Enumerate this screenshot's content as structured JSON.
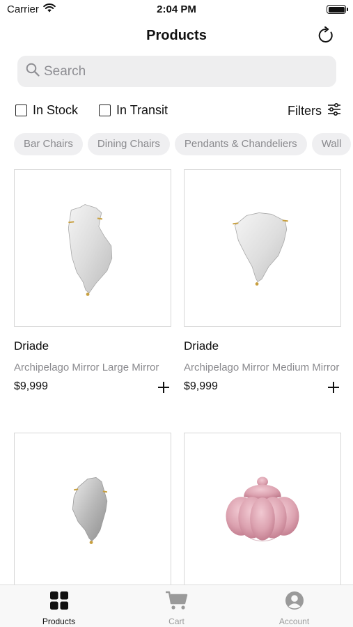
{
  "status_bar": {
    "carrier": "Carrier",
    "time": "2:04 PM"
  },
  "header": {
    "title": "Products",
    "refresh_icon": "refresh-icon"
  },
  "search": {
    "placeholder": "Search",
    "value": ""
  },
  "filters": {
    "in_stock_label": "In Stock",
    "in_stock_checked": false,
    "in_transit_label": "In Transit",
    "in_transit_checked": false,
    "filters_label": "Filters"
  },
  "categories": [
    "Bar Chairs",
    "Dining Chairs",
    "Pendants & Chandeliers",
    "Wall"
  ],
  "products": [
    {
      "brand": "Driade",
      "name": "Archipelago Mirror Large Mirror",
      "price": "$9,999",
      "image": "mirror"
    },
    {
      "brand": "Driade",
      "name": "Archipelago Mirror Medium Mirror",
      "price": "$9,999",
      "image": "mirror"
    },
    {
      "brand": "",
      "name": "",
      "price": "",
      "image": "mirror"
    },
    {
      "brand": "",
      "name": "",
      "price": "",
      "image": "pink-ceramic-jar"
    }
  ],
  "tabs": [
    {
      "label": "Products",
      "icon": "grid-icon",
      "active": true
    },
    {
      "label": "Cart",
      "icon": "cart-icon",
      "active": false
    },
    {
      "label": "Account",
      "icon": "account-icon",
      "active": false
    }
  ],
  "colors": {
    "accent": "#111111",
    "chip_bg": "#efeff1",
    "muted_text": "#8a8a8e",
    "search_bg": "#eeeeef"
  }
}
